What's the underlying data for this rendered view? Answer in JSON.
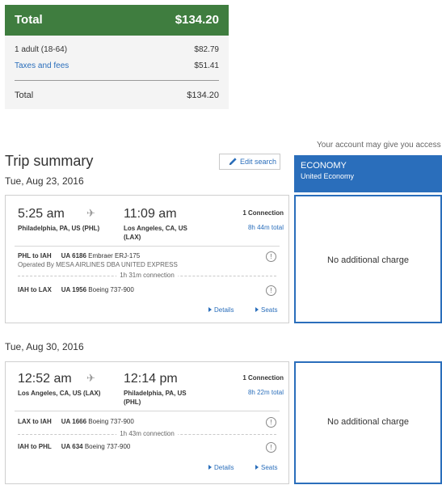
{
  "price_summary": {
    "header_label": "Total",
    "header_value": "$134.20",
    "rows": [
      {
        "label": "1 adult (18-64)",
        "value": "$82.79"
      },
      {
        "label": "Taxes and fees",
        "value": "$51.41"
      }
    ],
    "total_label": "Total",
    "total_value": "$134.20"
  },
  "account_note": "Your account may give you access to",
  "fare_column": {
    "title": "ECONOMY",
    "subtitle": "United Economy",
    "cells": [
      "No additional charge",
      "No additional charge"
    ]
  },
  "trip": {
    "title": "Trip summary",
    "edit_label": "Edit search",
    "flights": [
      {
        "date": "Tue, Aug 23, 2016",
        "depart_time": "5:25 am",
        "depart_city": "Philadelphia, PA, US (PHL)",
        "arrive_time": "11:09 am",
        "arrive_city_1": "Los Angeles, CA, US",
        "arrive_city_2": "(LAX)",
        "connections": "1 Connection",
        "duration": "8h 44m total",
        "segments": [
          {
            "route": "PHL to IAH",
            "flight": "UA 6186",
            "aircraft": "Embraer ERJ-175"
          },
          {
            "route": "IAH to LAX",
            "flight": "UA 1956",
            "aircraft": "Boeing 737-900"
          }
        ],
        "operated_by": "Operated By MESA AIRLINES DBA UNITED EXPRESS",
        "connection_time": "1h 31m connection",
        "details_label": "Details",
        "seats_label": "Seats"
      },
      {
        "date": "Tue, Aug 30, 2016",
        "depart_time": "12:52 am",
        "depart_city": "Los Angeles, CA, US (LAX)",
        "arrive_time": "12:14 pm",
        "arrive_city_1": "Philadelphia, PA, US",
        "arrive_city_2": "(PHL)",
        "connections": "1 Connection",
        "duration": "8h 22m total",
        "segments": [
          {
            "route": "LAX to IAH",
            "flight": "UA 1666",
            "aircraft": "Boeing 737-900"
          },
          {
            "route": "IAH to PHL",
            "flight": "UA 634",
            "aircraft": "Boeing 737-900"
          }
        ],
        "connection_time": "1h 43m connection",
        "details_label": "Details",
        "seats_label": "Seats"
      }
    ]
  },
  "icons": {
    "plane": "✈",
    "info": "!"
  },
  "colors": {
    "total_header_bg": "#3f7d3f",
    "accent_blue": "#2a6ebb"
  }
}
